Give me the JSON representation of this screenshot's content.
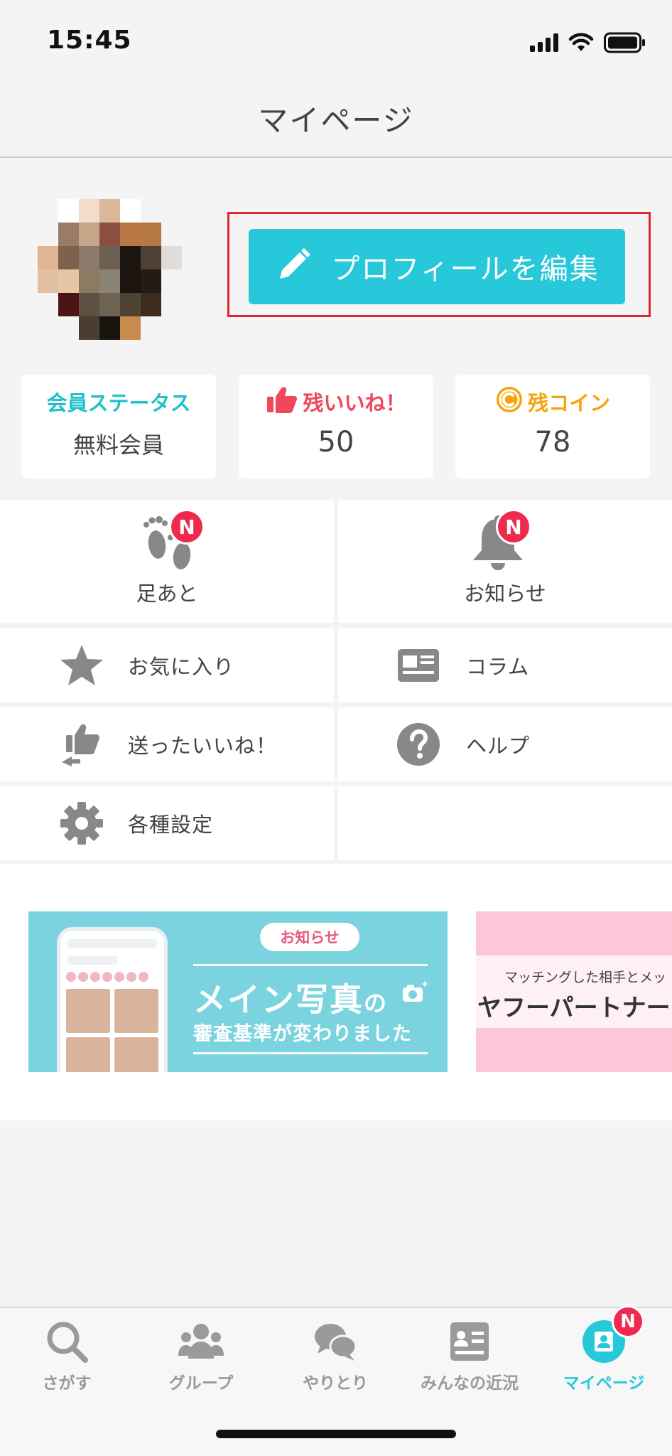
{
  "status_bar": {
    "time": "15:45"
  },
  "header": {
    "title": "マイページ"
  },
  "profile": {
    "edit_button_label": "プロフィールを編集",
    "avatar_pixels": [
      [
        "#f4f4f4",
        "#ffffff",
        "#f2dccb",
        "#dcb89a",
        "#ffffff",
        "#f4f4f4",
        "#f4f4f4",
        "#f4f4f4"
      ],
      [
        "#f4f4f4",
        "#9a7c66",
        "#c8a68a",
        "#8c4f3f",
        "#b77845",
        "#b57845",
        "#f4f4f4",
        "#f4f4f4"
      ],
      [
        "#dfb594",
        "#7d6250",
        "#8e7a6a",
        "#6d6052",
        "#1c1510",
        "#4e4237",
        "#e0dcd8",
        "#f4f4f4"
      ],
      [
        "#e2bea2",
        "#e6c7a5",
        "#8c7a62",
        "#8a8272",
        "#1b140f",
        "#241b14",
        "#f4f4f4",
        "#f4f4f4"
      ],
      [
        "#f4f4f4",
        "#4b1414",
        "#5e5142",
        "#6f6454",
        "#4e4232",
        "#3c2c1e",
        "#f4f4f4",
        "#f4f4f4"
      ],
      [
        "#f4f4f4",
        "#f4f4f4",
        "#4a3e32",
        "#1a140f",
        "#c98a4e",
        "#f4f4f4",
        "#f4f4f4",
        "#f4f4f4"
      ]
    ]
  },
  "stats": {
    "membership": {
      "title": "会員ステータス",
      "value": "無料会員"
    },
    "likes": {
      "title": "残いいね！",
      "value": "50"
    },
    "coins": {
      "title": "残コイン",
      "value": "78"
    }
  },
  "menu": {
    "footprints": {
      "label": "足あと",
      "badge": "N"
    },
    "notices": {
      "label": "お知らせ",
      "badge": "N"
    },
    "favorites": {
      "label": "お気に入り"
    },
    "column": {
      "label": "コラム"
    },
    "sent_likes": {
      "label": "送ったいいね！"
    },
    "help": {
      "label": "ヘルプ"
    },
    "settings": {
      "label": "各種設定"
    }
  },
  "banners": {
    "banner1": {
      "tag": "お知らせ",
      "headline_main": "メイン写真",
      "headline_suffix": "の",
      "subline": "審査基準が変わりました"
    },
    "banner2": {
      "small": "マッチングした相手とメッ",
      "big": "ヤフーパートナーの"
    }
  },
  "tabbar": {
    "search": "さがす",
    "group": "グループ",
    "messages": "やりとり",
    "news": "みんなの近況",
    "mypage": "マイページ",
    "mypage_badge": "N"
  },
  "colors": {
    "accent": "#26c8da",
    "badge": "#ef2a4e",
    "membership_title": "#1fc2c9",
    "likes_title": "#f0475c",
    "coins_title": "#f5a40b",
    "highlight_frame": "#e0262e"
  },
  "icons": [
    "pencil-icon",
    "thumbs-up-icon",
    "coin-icon",
    "footprints-icon",
    "bell-icon",
    "star-icon",
    "newspaper-icon",
    "sent-like-icon",
    "help-icon",
    "gear-icon",
    "search-icon",
    "group-icon",
    "chat-icon",
    "news-icon",
    "mypage-icon"
  ]
}
